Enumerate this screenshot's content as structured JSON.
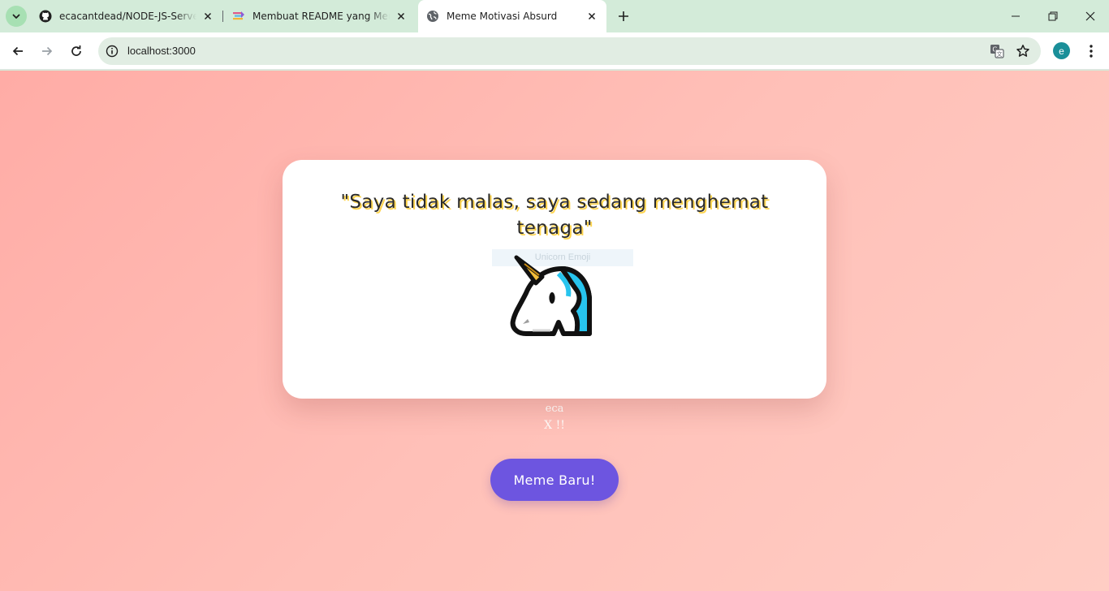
{
  "browser": {
    "tabs": [
      {
        "title": "ecacantdead/NODE-JS-Server: R",
        "favicon": "github-icon"
      },
      {
        "title": "Membuat README yang Menar",
        "favicon": "site-icon"
      },
      {
        "title": "Meme Motivasi Absurd",
        "favicon": "globe-icon",
        "active": true
      }
    ],
    "address": "localhost:3000",
    "profile_initial": "e"
  },
  "page": {
    "quote": "\"Saya tidak malas, saya sedang menghemat tenaga\"",
    "image_alt": "Unicorn Emoji",
    "author_line1": "eca",
    "author_line2": "X !!",
    "new_meme_button": "Meme Baru!"
  },
  "colors": {
    "tab_strip": "#d3ebd9",
    "omnibox": "#e1ede3",
    "page_bg_start": "#ffaca6",
    "page_bg_end": "#ffcdc4",
    "button_bg": "#6d55e0",
    "quote_shadow": "#ffd44d",
    "profile_bg": "#1a8f99"
  }
}
